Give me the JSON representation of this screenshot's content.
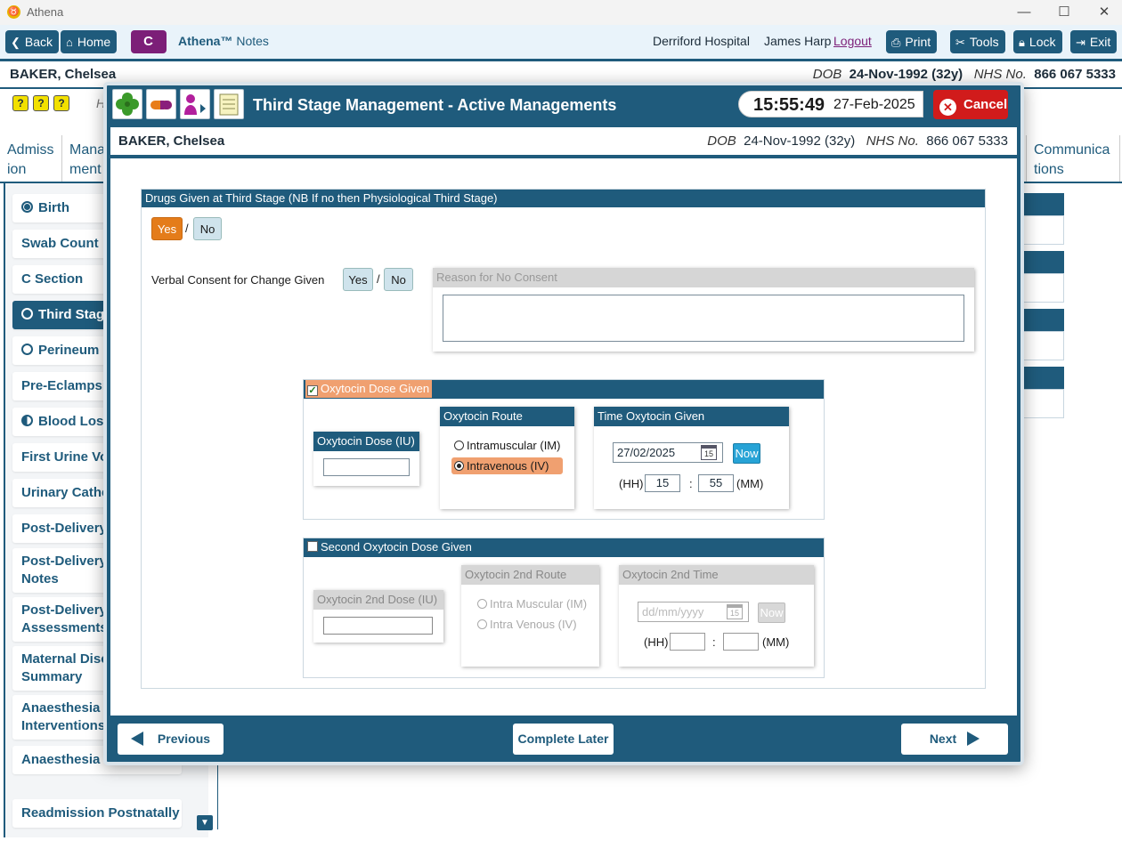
{
  "window": {
    "title": "Athena",
    "logo": "athena-logo",
    "minimize": "—",
    "maximize": "☐",
    "close": "✕"
  },
  "toolbar": {
    "back": "Back",
    "home": "Home",
    "c": "C",
    "app_brand": "Athena™",
    "app_section": "Notes",
    "hospital": "Derriford Hospital",
    "user": "James Harp",
    "logout": "Logout",
    "print": "Print",
    "tools": "Tools",
    "lock": "Lock",
    "exit": "Exit"
  },
  "patient": {
    "name": "BAKER, Chelsea",
    "dob_label": "DOB",
    "dob": "24-Nov-1992 (32y)",
    "nhs_label": "NHS No.",
    "nhs": "866 067 5333"
  },
  "background": {
    "help_badges": [
      "?",
      "?",
      "?"
    ],
    "h_fragment": "H",
    "tabs": [
      {
        "line1": "Admiss",
        "line2": "ion"
      },
      {
        "line1": "Mana",
        "line2": "ment"
      },
      {
        "line1": "Communica",
        "line2": "tions"
      }
    ],
    "sidebar": [
      {
        "label": "Birth",
        "radio": "full"
      },
      {
        "label": "Swab Count",
        "radio": "none"
      },
      {
        "label": "C Section",
        "radio": "none"
      },
      {
        "label": "Third Stage",
        "radio": "empty"
      },
      {
        "label": "Perineum",
        "radio": "empty"
      },
      {
        "label": "Pre-Eclampsia",
        "radio": "none"
      },
      {
        "label": "Blood Loss",
        "radio": "half"
      },
      {
        "label": "First Urine Voi",
        "radio": "none"
      },
      {
        "label": "Urinary Cathe",
        "radio": "none"
      },
      {
        "label": "Post-Delivery",
        "radio": "none"
      },
      {
        "label": "Post-Delivery\nNotes",
        "radio": "none"
      },
      {
        "label": "Post-Delivery\nAssessments",
        "radio": "none"
      },
      {
        "label": "Maternal Disc\nSummary",
        "radio": "none"
      },
      {
        "label": "Anaesthesia\nInterventions",
        "radio": "none"
      },
      {
        "label": "Anaesthesia F",
        "radio": "none"
      },
      {
        "label": "Readmission Postnatally",
        "radio": "none"
      }
    ]
  },
  "modal": {
    "icons": [
      "clover-icon",
      "pill-icon",
      "person-arrow-icon",
      "notepad-icon"
    ],
    "title": "Third Stage Management - Active Managements",
    "clock_time": "15:55:49",
    "clock_date": "27-Feb-2025",
    "cancel": "Cancel",
    "drugs_header": "Drugs Given at Third Stage (NB If no then Physiological Third Stage)",
    "drugs_yes": "Yes",
    "drugs_no": "No",
    "slash": "/",
    "drugs_selected": "Yes",
    "consent_label": "Verbal Consent for Change Given",
    "consent_yes": "Yes",
    "consent_no": "No",
    "reason_header": "Reason for No Consent",
    "reason_value": "",
    "oxy1": {
      "checked": true,
      "header": "Oxytocin Dose Given",
      "dose_header": "Oxytocin Dose (IU)",
      "dose_value": "",
      "route_header": "Oxytocin Route",
      "route_im": "Intramuscular (IM)",
      "route_iv": "Intravenous (IV)",
      "route_selected": "Intravenous (IV)",
      "time_header": "Time Oxytocin Given",
      "date": "27/02/2025",
      "cal_day": "15",
      "now": "Now",
      "hh_label": "(HH)",
      "hh": "15",
      "colon": ":",
      "mm": "55",
      "mm_label": "(MM)"
    },
    "oxy2": {
      "checked": false,
      "header": "Second Oxytocin Dose Given",
      "dose_header": "Oxytocin 2nd Dose (IU)",
      "dose_value": "",
      "route_header": "Oxytocin 2nd Route",
      "route_im": "Intra Muscular (IM)",
      "route_iv": "Intra Venous (IV)",
      "time_header": "Oxytocin 2nd Time",
      "date_placeholder": "dd/mm/yyyy",
      "cal_day": "15",
      "now": "Now",
      "hh_label": "(HH)",
      "hh": "",
      "colon": ":",
      "mm": "",
      "mm_label": "(MM)"
    },
    "previous": "Previous",
    "complete_later": "Complete Later",
    "next": "Next"
  },
  "colors": {
    "primary": "#1f5b7c",
    "accent_orange": "#e47c1a",
    "cancel_red": "#d11b1b",
    "c_purple": "#7c1f78",
    "now_blue": "#27a3d6"
  }
}
